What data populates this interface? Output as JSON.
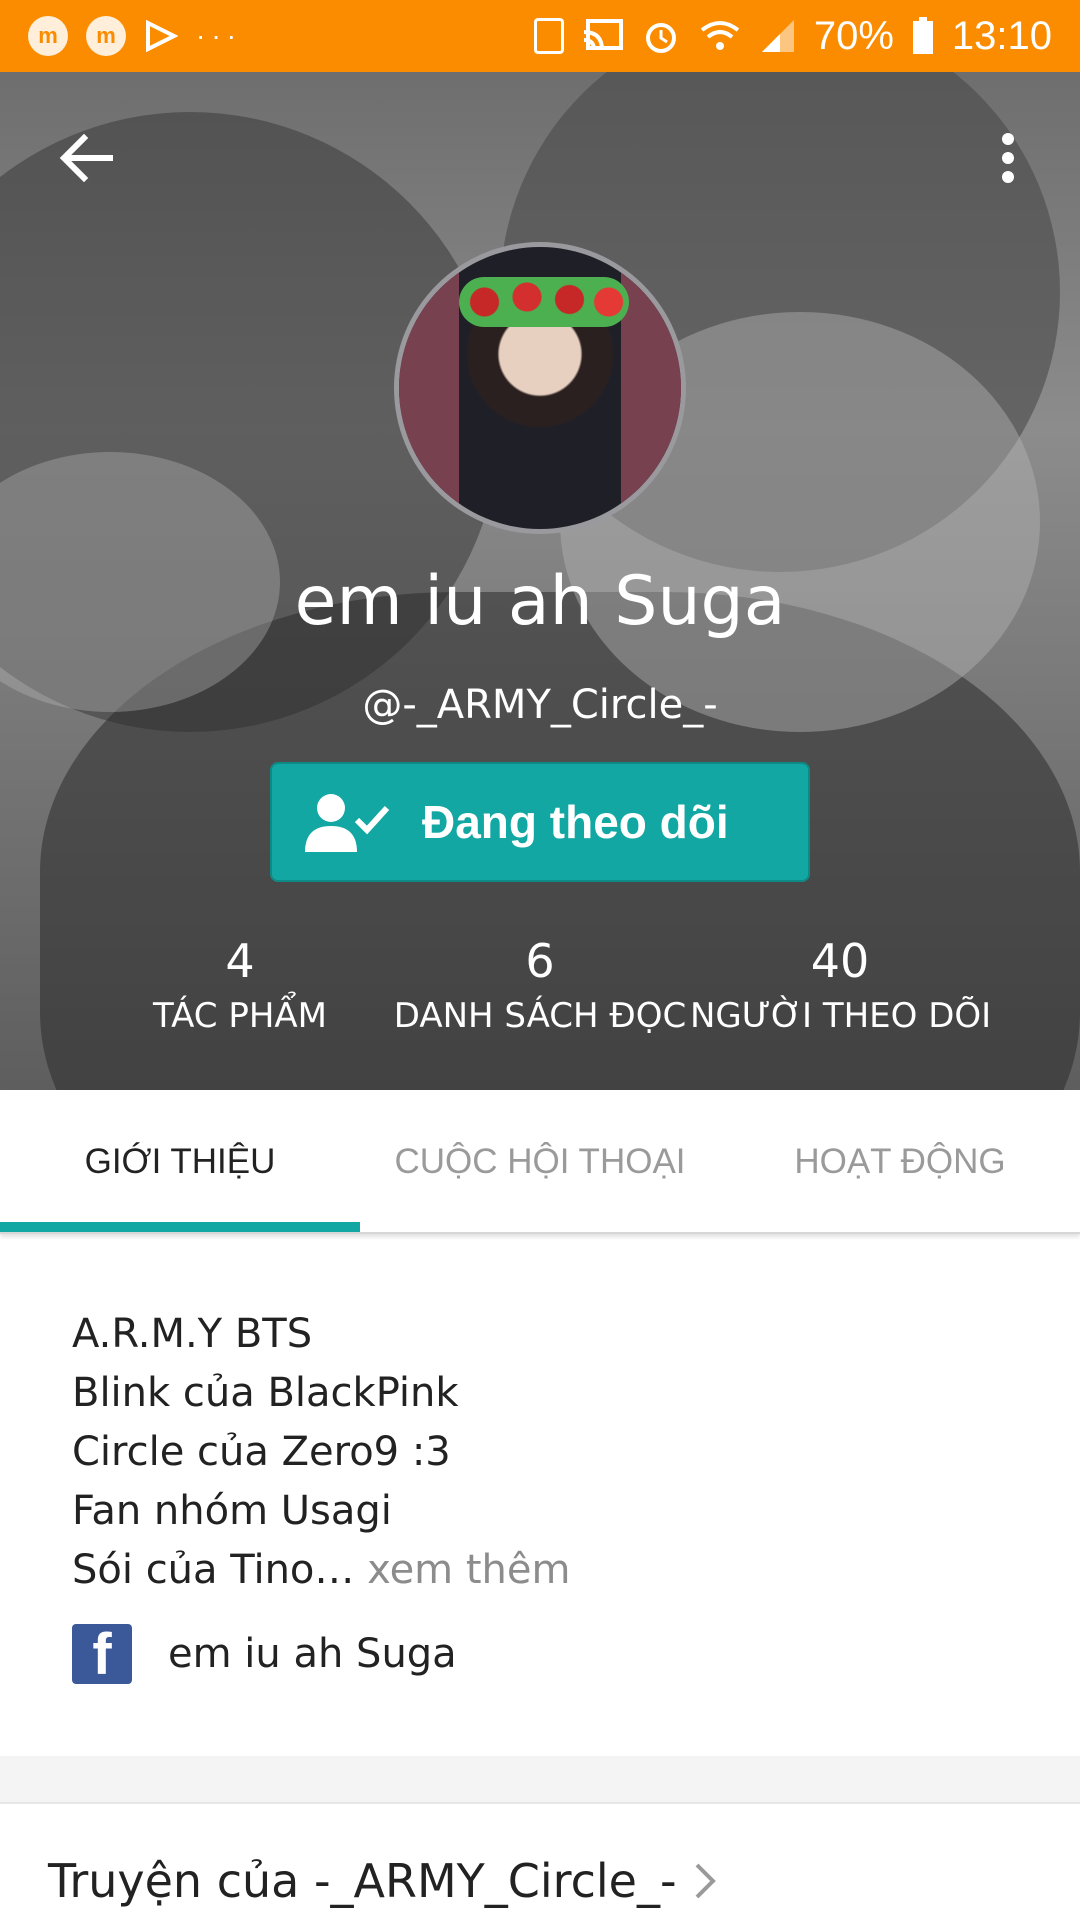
{
  "status_bar": {
    "battery": "70%",
    "time": "13:10",
    "dots": "···"
  },
  "header": {
    "display_name": "em iu ah Suga",
    "username": "@-_ARMY_Circle_-",
    "follow_label": "Đang theo dõi"
  },
  "stats": [
    {
      "value": "4",
      "label": "TÁC PHẨM"
    },
    {
      "value": "6",
      "label": "DANH SÁCH ĐỌC"
    },
    {
      "value": "40",
      "label": "NGƯỜI THEO DÕI"
    }
  ],
  "tabs": [
    {
      "label": "GIỚI THIỆU"
    },
    {
      "label": "CUỘC HỘI THOẠI"
    },
    {
      "label": "HOẠT ĐỘNG"
    }
  ],
  "about": {
    "lines": [
      "A.R.M.Y BTS",
      "Blink của BlackPink",
      "Circle của Zero9 :3",
      "Fan nhóm Usagi"
    ],
    "last_line": "Sói của Tino…",
    "see_more": " xem thêm",
    "facebook_name": "em iu ah Suga"
  },
  "stories": {
    "title": "Truyện của -_ARMY_Circle_-"
  },
  "colors": {
    "status_bar": "#fb8c00",
    "accent": "#12a7a3",
    "facebook": "#3b5998"
  },
  "icons": [
    "back-arrow-icon",
    "more-vert-icon",
    "user-check-icon",
    "facebook-icon",
    "chevron-right-icon",
    "battery-icon",
    "wifi-icon",
    "signal-icon",
    "alarm-icon",
    "cast-icon"
  ]
}
